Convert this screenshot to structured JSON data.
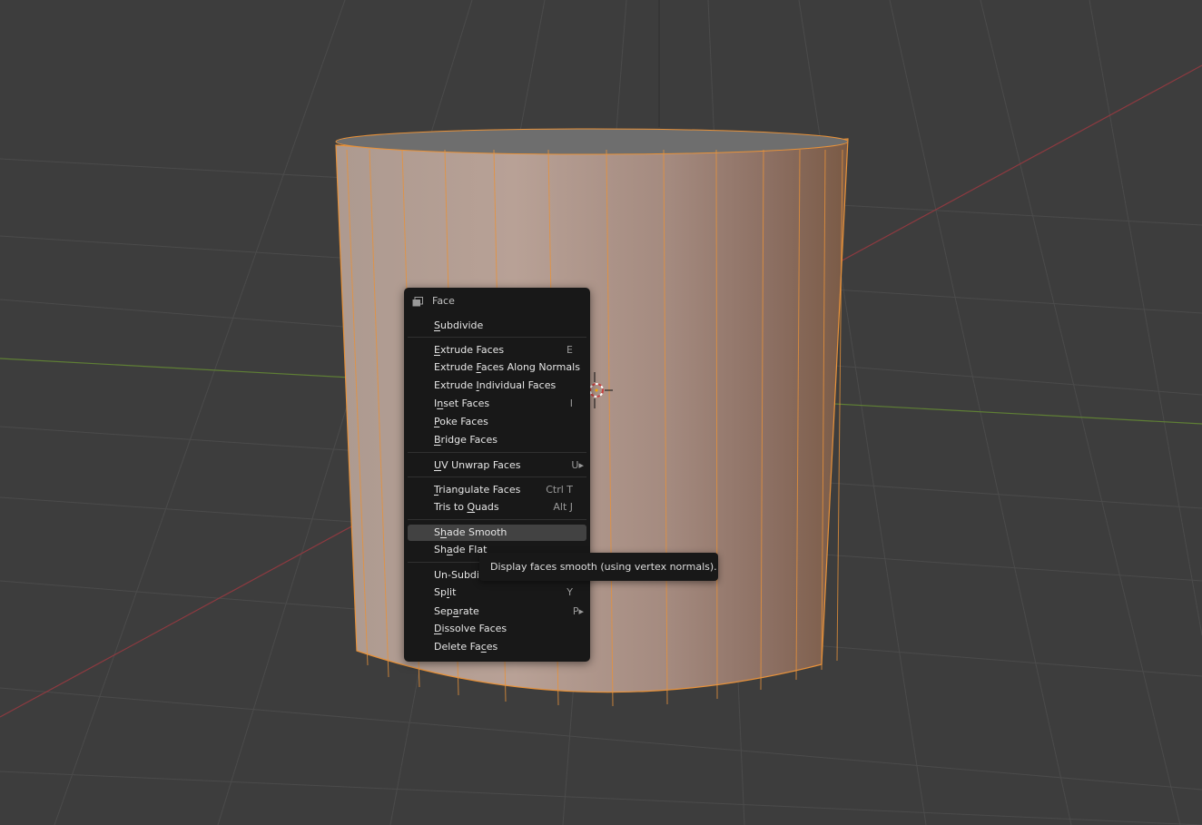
{
  "colors": {
    "background": "#3d3d3d",
    "grid_line": "#4a4a4a",
    "x_axis": "#9c3a43",
    "y_axis": "#6b8f3a",
    "mesh_fill": "#b59c90",
    "mesh_edge": "#e8923a",
    "menu_bg": "#181818",
    "menu_highlight": "#424242"
  },
  "menu": {
    "title": "Face",
    "title_icon": "face-mode-icon",
    "items": [
      {
        "pre": "",
        "ul": "S",
        "post": "ubdivide",
        "shortcut": "",
        "group": 1
      },
      {
        "pre": "",
        "ul": "E",
        "post": "xtrude Faces",
        "shortcut": "E",
        "group": 2
      },
      {
        "pre": "Extrude ",
        "ul": "F",
        "post": "aces Along Normals",
        "shortcut": "",
        "group": 2
      },
      {
        "pre": "Extrude ",
        "ul": "I",
        "post": "ndividual Faces",
        "shortcut": "",
        "group": 2
      },
      {
        "pre": "I",
        "ul": "n",
        "post": "set Faces",
        "shortcut": "I",
        "group": 2
      },
      {
        "pre": "",
        "ul": "P",
        "post": "oke Faces",
        "shortcut": "",
        "group": 2
      },
      {
        "pre": "",
        "ul": "B",
        "post": "ridge Faces",
        "shortcut": "",
        "group": 2
      },
      {
        "pre": "",
        "ul": "U",
        "post": "V Unwrap Faces",
        "shortcut": "U▸",
        "group": 3
      },
      {
        "pre": "",
        "ul": "T",
        "post": "riangulate Faces",
        "shortcut": "Ctrl T",
        "group": 4
      },
      {
        "pre": "Tris to ",
        "ul": "Q",
        "post": "uads",
        "shortcut": "Alt J",
        "group": 4
      },
      {
        "pre": "S",
        "ul": "h",
        "post": "ade Smooth",
        "shortcut": "",
        "group": 5,
        "active": true
      },
      {
        "pre": "Sh",
        "ul": "a",
        "post": "de Flat",
        "shortcut": "",
        "group": 5
      },
      {
        "pre": "Un-Subdi",
        "ul": "",
        "post": "",
        "shortcut": "",
        "group": 6
      },
      {
        "pre": "Sp",
        "ul": "l",
        "post": "it",
        "shortcut": "Y",
        "group": 6
      },
      {
        "pre": "Sep",
        "ul": "a",
        "post": "rate",
        "shortcut": "P▸",
        "group": 6
      },
      {
        "pre": "",
        "ul": "D",
        "post": "issolve Faces",
        "shortcut": "",
        "group": 6
      },
      {
        "pre": "Delete Fa",
        "ul": "c",
        "post": "es",
        "shortcut": "",
        "group": 6
      }
    ]
  },
  "tooltip": {
    "text": "Display faces smooth (using vertex normals)."
  }
}
